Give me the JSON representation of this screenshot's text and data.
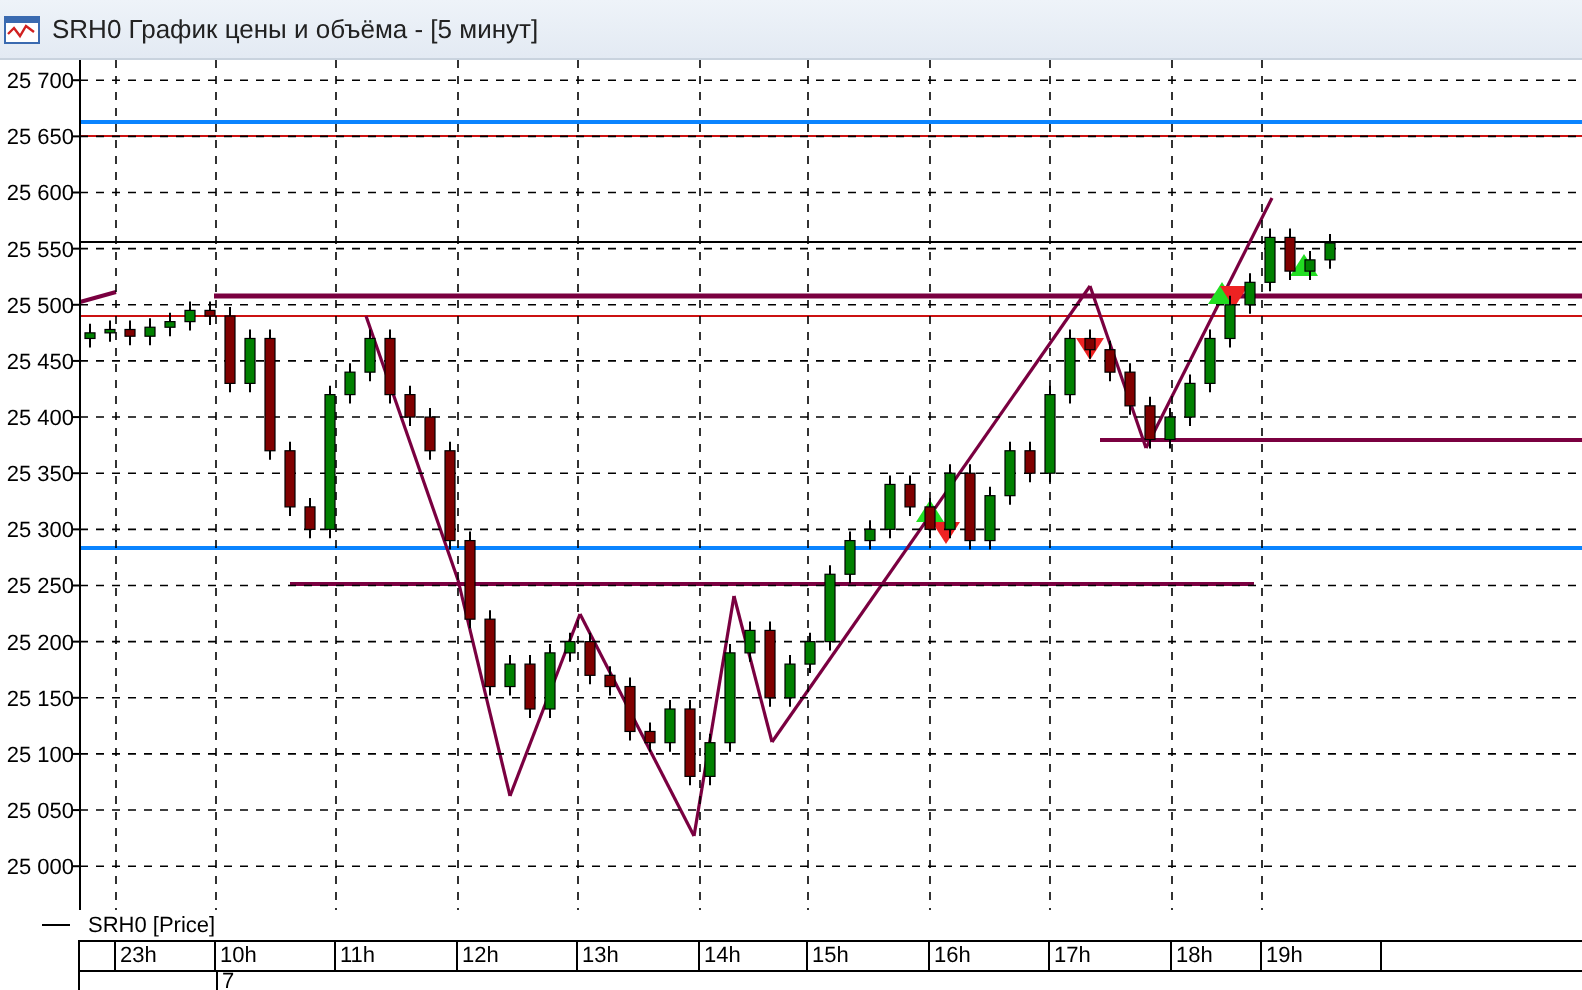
{
  "window": {
    "title": "SRH0 График цены и объёма - [5 минут]"
  },
  "chart": {
    "chart_data": {
      "type": "candlestick",
      "ylim": [
        24961,
        25718
      ],
      "yticks": [
        {
          "value": 25700,
          "label": "25 700"
        },
        {
          "value": 25650,
          "label": "25 650"
        },
        {
          "value": 25600,
          "label": "25 600"
        },
        {
          "value": 25550,
          "label": "25 550"
        },
        {
          "value": 25500,
          "label": "25 500"
        },
        {
          "value": 25450,
          "label": "25 450"
        },
        {
          "value": 25400,
          "label": "25 400"
        },
        {
          "value": 25350,
          "label": "25 350"
        },
        {
          "value": 25300,
          "label": "25 300"
        },
        {
          "value": 25250,
          "label": "25 250"
        },
        {
          "value": 25200,
          "label": "25 200"
        },
        {
          "value": 25150,
          "label": "25 150"
        },
        {
          "value": 25100,
          "label": "25 100"
        },
        {
          "value": 25050,
          "label": "25 050"
        },
        {
          "value": 25000,
          "label": "25 000"
        }
      ],
      "grid": true,
      "series": [
        {
          "name": "SRH0 [Price]",
          "color": "#000000",
          "ohlc": [
            [
              25470,
              25483,
              25462,
              25475
            ],
            [
              25475,
              25486,
              25467,
              25478
            ],
            [
              25478,
              25486,
              25464,
              25472
            ],
            [
              25472,
              25488,
              25464,
              25480
            ],
            [
              25480,
              25493,
              25472,
              25485
            ],
            [
              25485,
              25503,
              25477,
              25495
            ],
            [
              25495,
              25503,
              25482,
              25490
            ],
            [
              25490,
              25498,
              25422,
              25430
            ],
            [
              25430,
              25478,
              25422,
              25470
            ],
            [
              25470,
              25478,
              25362,
              25370
            ],
            [
              25370,
              25378,
              25312,
              25320
            ],
            [
              25320,
              25328,
              25292,
              25300
            ],
            [
              25300,
              25428,
              25292,
              25420
            ],
            [
              25420,
              25448,
              25412,
              25440
            ],
            [
              25440,
              25478,
              25432,
              25470
            ],
            [
              25470,
              25478,
              25412,
              25420
            ],
            [
              25420,
              25428,
              25392,
              25400
            ],
            [
              25400,
              25408,
              25362,
              25370
            ],
            [
              25370,
              25378,
              25282,
              25290
            ],
            [
              25290,
              25298,
              25212,
              25220
            ],
            [
              25220,
              25228,
              25152,
              25160
            ],
            [
              25160,
              25188,
              25152,
              25180
            ],
            [
              25180,
              25188,
              25132,
              25140
            ],
            [
              25140,
              25198,
              25132,
              25190
            ],
            [
              25190,
              25208,
              25182,
              25200
            ],
            [
              25200,
              25208,
              25162,
              25170
            ],
            [
              25170,
              25178,
              25152,
              25160
            ],
            [
              25160,
              25168,
              25112,
              25120
            ],
            [
              25120,
              25128,
              25102,
              25110
            ],
            [
              25110,
              25148,
              25102,
              25140
            ],
            [
              25140,
              25148,
              25072,
              25080
            ],
            [
              25080,
              25118,
              25072,
              25110
            ],
            [
              25110,
              25198,
              25102,
              25190
            ],
            [
              25190,
              25218,
              25182,
              25210
            ],
            [
              25210,
              25218,
              25142,
              25150
            ],
            [
              25150,
              25188,
              25142,
              25180
            ],
            [
              25180,
              25208,
              25172,
              25200
            ],
            [
              25200,
              25268,
              25192,
              25260
            ],
            [
              25260,
              25298,
              25252,
              25290
            ],
            [
              25290,
              25308,
              25282,
              25300
            ],
            [
              25300,
              25348,
              25292,
              25340
            ],
            [
              25340,
              25348,
              25312,
              25320
            ],
            [
              25320,
              25328,
              25292,
              25300
            ],
            [
              25300,
              25358,
              25292,
              25350
            ],
            [
              25350,
              25358,
              25282,
              25290
            ],
            [
              25290,
              25338,
              25282,
              25330
            ],
            [
              25330,
              25378,
              25322,
              25370
            ],
            [
              25370,
              25378,
              25342,
              25350
            ],
            [
              25350,
              25428,
              25342,
              25420
            ],
            [
              25420,
              25478,
              25412,
              25470
            ],
            [
              25470,
              25478,
              25452,
              25460
            ],
            [
              25460,
              25468,
              25432,
              25440
            ],
            [
              25440,
              25448,
              25402,
              25410
            ],
            [
              25410,
              25418,
              25372,
              25380
            ],
            [
              25380,
              25408,
              25372,
              25400
            ],
            [
              25400,
              25438,
              25392,
              25430
            ],
            [
              25430,
              25478,
              25422,
              25470
            ],
            [
              25470,
              25508,
              25462,
              25500
            ],
            [
              25500,
              25528,
              25492,
              25520
            ],
            [
              25520,
              25568,
              25512,
              25560
            ],
            [
              25560,
              25568,
              25522,
              25530
            ],
            [
              25530,
              25548,
              25522,
              25540
            ],
            [
              25540,
              25563,
              25532,
              25555
            ]
          ]
        }
      ]
    }
  },
  "time_axis": [
    "23h",
    "10h",
    "11h",
    "12h",
    "13h",
    "14h",
    "15h",
    "16h",
    "17h",
    "18h",
    "19h"
  ],
  "bottom_row": {
    "label": "7"
  }
}
